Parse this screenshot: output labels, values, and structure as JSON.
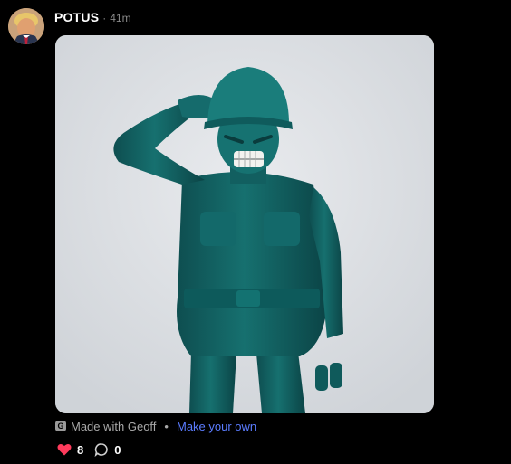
{
  "post": {
    "username": "POTUS",
    "separator": "·",
    "timestamp": "41m"
  },
  "credit": {
    "made_with": "Made with Geoff",
    "separator": "•",
    "make_own": "Make your own",
    "link_color": "#5b7cff"
  },
  "actions": {
    "likes": "8",
    "comments": "0",
    "like_color": "#ff3b5c"
  },
  "icons": {
    "avatar": "profile-avatar",
    "logo": "geoff-logo-icon",
    "like": "heart-icon",
    "comment": "comment-bubble-icon"
  },
  "image": {
    "subject": "teal plastic toy soldier saluting, snarling face"
  }
}
